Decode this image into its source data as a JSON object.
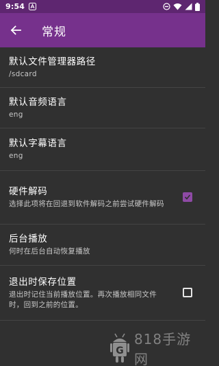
{
  "status_bar": {
    "time": "9:54",
    "notification_icon": "a-badge-icon",
    "icons": [
      "dnd-icon",
      "wifi-icon",
      "signal-icon",
      "battery-icon"
    ]
  },
  "app_bar": {
    "title": "常规",
    "back_icon": "arrow-left-icon"
  },
  "settings": [
    {
      "title": "默认文件管理器路径",
      "summary": "/sdcard"
    },
    {
      "title": "默认音频语言",
      "summary": "eng"
    },
    {
      "title": "默认字幕语言",
      "summary": "eng"
    },
    {
      "title": "硬件解码",
      "summary": "选择此项将在回退到软件解码之前尝试硬件解码",
      "checkbox": true,
      "checked": true
    },
    {
      "title": "后台播放",
      "summary": "何时在后台自动恢复播放"
    },
    {
      "title": "退出时保存位置",
      "summary": "退出时记住当前播放位置。再次播放相同文件时，回到之前的位置。",
      "checkbox": true,
      "checked": false
    }
  ],
  "watermark": {
    "text": "818手游网",
    "logo_letter": "G"
  },
  "colors": {
    "status_bar": "#5e2670",
    "app_bar": "#76318c",
    "background": "#303030",
    "accent": "#8e4aa5"
  }
}
